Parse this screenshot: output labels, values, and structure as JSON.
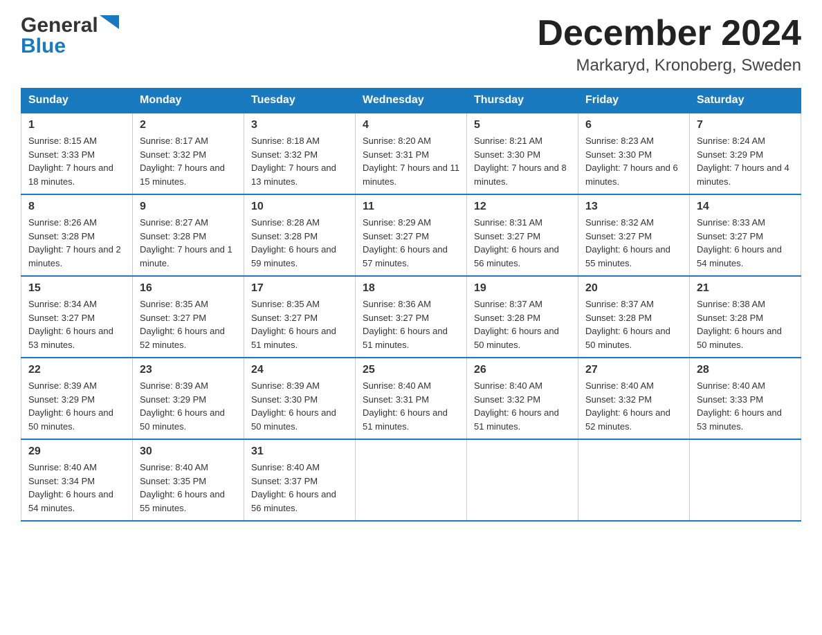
{
  "header": {
    "logo_general": "General",
    "logo_blue": "Blue",
    "month_title": "December 2024",
    "location": "Markaryd, Kronoberg, Sweden"
  },
  "days_of_week": [
    "Sunday",
    "Monday",
    "Tuesday",
    "Wednesday",
    "Thursday",
    "Friday",
    "Saturday"
  ],
  "weeks": [
    [
      {
        "day": "1",
        "sunrise": "8:15 AM",
        "sunset": "3:33 PM",
        "daylight": "7 hours and 18 minutes."
      },
      {
        "day": "2",
        "sunrise": "8:17 AM",
        "sunset": "3:32 PM",
        "daylight": "7 hours and 15 minutes."
      },
      {
        "day": "3",
        "sunrise": "8:18 AM",
        "sunset": "3:32 PM",
        "daylight": "7 hours and 13 minutes."
      },
      {
        "day": "4",
        "sunrise": "8:20 AM",
        "sunset": "3:31 PM",
        "daylight": "7 hours and 11 minutes."
      },
      {
        "day": "5",
        "sunrise": "8:21 AM",
        "sunset": "3:30 PM",
        "daylight": "7 hours and 8 minutes."
      },
      {
        "day": "6",
        "sunrise": "8:23 AM",
        "sunset": "3:30 PM",
        "daylight": "7 hours and 6 minutes."
      },
      {
        "day": "7",
        "sunrise": "8:24 AM",
        "sunset": "3:29 PM",
        "daylight": "7 hours and 4 minutes."
      }
    ],
    [
      {
        "day": "8",
        "sunrise": "8:26 AM",
        "sunset": "3:28 PM",
        "daylight": "7 hours and 2 minutes."
      },
      {
        "day": "9",
        "sunrise": "8:27 AM",
        "sunset": "3:28 PM",
        "daylight": "7 hours and 1 minute."
      },
      {
        "day": "10",
        "sunrise": "8:28 AM",
        "sunset": "3:28 PM",
        "daylight": "6 hours and 59 minutes."
      },
      {
        "day": "11",
        "sunrise": "8:29 AM",
        "sunset": "3:27 PM",
        "daylight": "6 hours and 57 minutes."
      },
      {
        "day": "12",
        "sunrise": "8:31 AM",
        "sunset": "3:27 PM",
        "daylight": "6 hours and 56 minutes."
      },
      {
        "day": "13",
        "sunrise": "8:32 AM",
        "sunset": "3:27 PM",
        "daylight": "6 hours and 55 minutes."
      },
      {
        "day": "14",
        "sunrise": "8:33 AM",
        "sunset": "3:27 PM",
        "daylight": "6 hours and 54 minutes."
      }
    ],
    [
      {
        "day": "15",
        "sunrise": "8:34 AM",
        "sunset": "3:27 PM",
        "daylight": "6 hours and 53 minutes."
      },
      {
        "day": "16",
        "sunrise": "8:35 AM",
        "sunset": "3:27 PM",
        "daylight": "6 hours and 52 minutes."
      },
      {
        "day": "17",
        "sunrise": "8:35 AM",
        "sunset": "3:27 PM",
        "daylight": "6 hours and 51 minutes."
      },
      {
        "day": "18",
        "sunrise": "8:36 AM",
        "sunset": "3:27 PM",
        "daylight": "6 hours and 51 minutes."
      },
      {
        "day": "19",
        "sunrise": "8:37 AM",
        "sunset": "3:28 PM",
        "daylight": "6 hours and 50 minutes."
      },
      {
        "day": "20",
        "sunrise": "8:37 AM",
        "sunset": "3:28 PM",
        "daylight": "6 hours and 50 minutes."
      },
      {
        "day": "21",
        "sunrise": "8:38 AM",
        "sunset": "3:28 PM",
        "daylight": "6 hours and 50 minutes."
      }
    ],
    [
      {
        "day": "22",
        "sunrise": "8:39 AM",
        "sunset": "3:29 PM",
        "daylight": "6 hours and 50 minutes."
      },
      {
        "day": "23",
        "sunrise": "8:39 AM",
        "sunset": "3:29 PM",
        "daylight": "6 hours and 50 minutes."
      },
      {
        "day": "24",
        "sunrise": "8:39 AM",
        "sunset": "3:30 PM",
        "daylight": "6 hours and 50 minutes."
      },
      {
        "day": "25",
        "sunrise": "8:40 AM",
        "sunset": "3:31 PM",
        "daylight": "6 hours and 51 minutes."
      },
      {
        "day": "26",
        "sunrise": "8:40 AM",
        "sunset": "3:32 PM",
        "daylight": "6 hours and 51 minutes."
      },
      {
        "day": "27",
        "sunrise": "8:40 AM",
        "sunset": "3:32 PM",
        "daylight": "6 hours and 52 minutes."
      },
      {
        "day": "28",
        "sunrise": "8:40 AM",
        "sunset": "3:33 PM",
        "daylight": "6 hours and 53 minutes."
      }
    ],
    [
      {
        "day": "29",
        "sunrise": "8:40 AM",
        "sunset": "3:34 PM",
        "daylight": "6 hours and 54 minutes."
      },
      {
        "day": "30",
        "sunrise": "8:40 AM",
        "sunset": "3:35 PM",
        "daylight": "6 hours and 55 minutes."
      },
      {
        "day": "31",
        "sunrise": "8:40 AM",
        "sunset": "3:37 PM",
        "daylight": "6 hours and 56 minutes."
      },
      null,
      null,
      null,
      null
    ]
  ]
}
